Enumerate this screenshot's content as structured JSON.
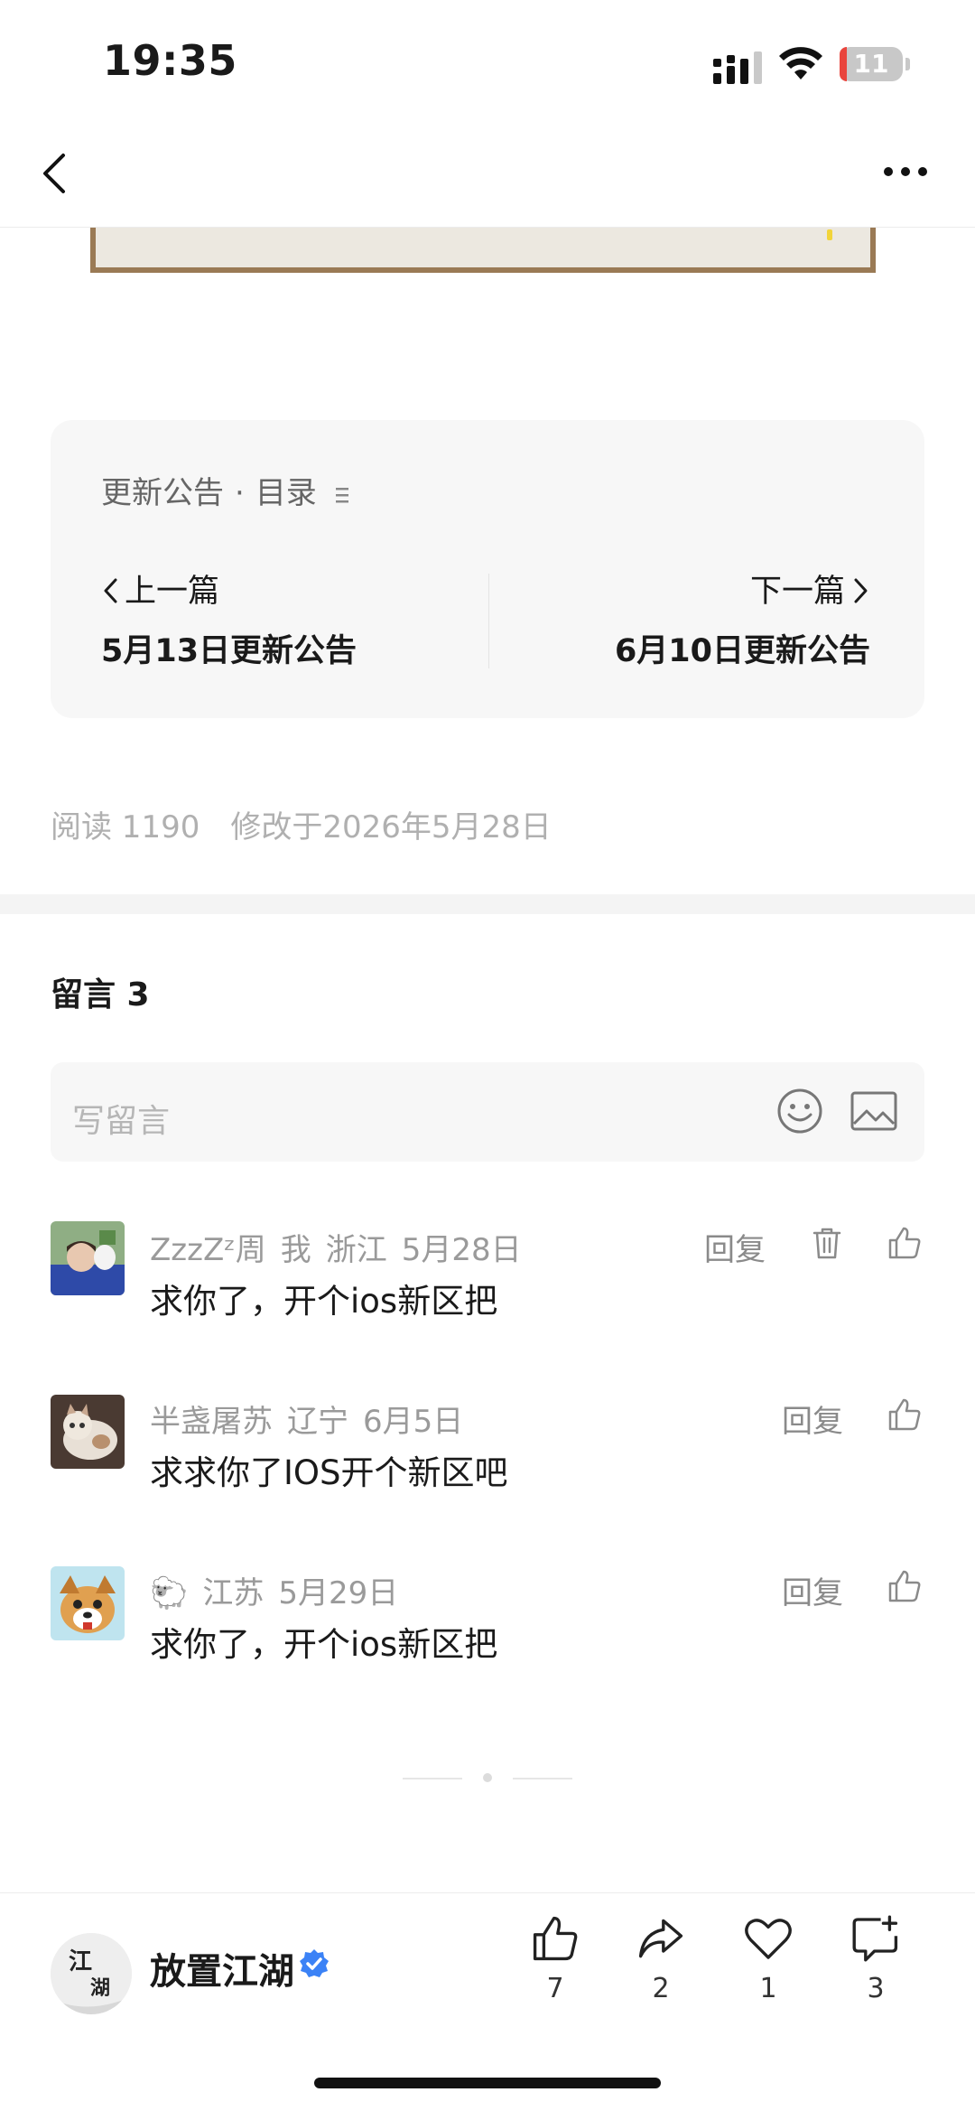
{
  "status_bar": {
    "time": "19:35",
    "battery": "11",
    "battery_level_percent": 11,
    "battery_color": "#e9453d"
  },
  "nav": {
    "back_icon": "chevron-left-icon",
    "more_icon": "more-horizontal-icon"
  },
  "collection": {
    "name": "更新公告",
    "separator": "·",
    "toc_label": "目录",
    "prev": {
      "label": "上一篇",
      "title": "5月13日更新公告"
    },
    "next": {
      "label": "下一篇",
      "title": "6月10日更新公告"
    }
  },
  "meta": {
    "reads": "阅读 1190",
    "modified": "修改于2026年5月28日"
  },
  "comments": {
    "header": "留言 3",
    "input_placeholder": "写留言",
    "items": [
      {
        "name": "ZzzZᶻ周",
        "tag": "我",
        "location": "浙江",
        "date": "5月28日",
        "reply": "回复",
        "text": "求你了，开个ios新区把",
        "can_delete": true
      },
      {
        "name": "半盏屠苏",
        "tag": "",
        "location": "辽宁",
        "date": "6月5日",
        "reply": "回复",
        "text": "求求你了IOS开个新区吧",
        "can_delete": false
      },
      {
        "name": "🐑",
        "tag": "",
        "location": "江苏",
        "date": "5月29日",
        "reply": "回复",
        "text": "求你了，开个ios新区把",
        "can_delete": false
      }
    ]
  },
  "bottom_bar": {
    "account_name": "放置江湖",
    "avatar_text_top": "江",
    "avatar_text_bottom": "湖",
    "like_count": "7",
    "share_count": "2",
    "favorite_count": "1",
    "comment_count": "3",
    "accent": "#3b82f6"
  }
}
